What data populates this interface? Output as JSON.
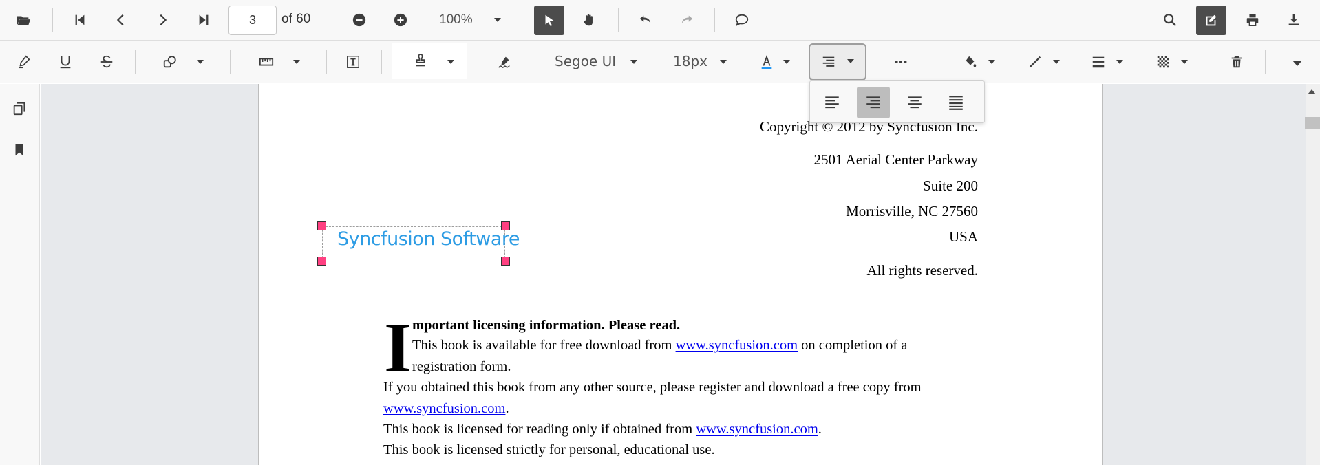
{
  "toolbar_top": {
    "open_icon": "folder-open-icon",
    "first_page_icon": "first-page-icon",
    "prev_page_icon": "prev-page-icon",
    "next_page_icon": "next-page-icon",
    "last_page_icon": "last-page-icon",
    "current_page": "3",
    "total_pages_label": "of 60",
    "zoom_out_icon": "zoom-out-icon",
    "zoom_in_icon": "zoom-in-icon",
    "zoom_value": "100%",
    "select_tool_icon": "pointer-icon",
    "pan_tool_icon": "hand-icon",
    "undo_icon": "undo-icon",
    "redo_icon": "redo-icon",
    "comment_icon": "comment-icon",
    "search_icon": "search-icon",
    "annotation_icon": "edit-annotation-icon",
    "print_icon": "print-icon",
    "download_icon": "download-icon"
  },
  "toolbar_annotation": {
    "font_family": "Segoe UI",
    "font_size": "18px",
    "font_color_icon": "font-color-icon",
    "align_icon": "align-right-icon",
    "more_icon": "more-icon",
    "fill_color_icon": "fill-color-icon",
    "stroke_color_icon": "stroke-color-icon",
    "thickness_icon": "thickness-icon",
    "opacity_icon": "opacity-icon",
    "delete_icon": "delete-icon",
    "accent_underline_color": "#2196f3"
  },
  "align_popup": {
    "options": [
      "align-left",
      "align-right",
      "align-center",
      "align-justify"
    ],
    "selected": "align-right"
  },
  "sidebar": {
    "items": [
      "page-thumbnails-icon",
      "bookmarks-icon"
    ]
  },
  "document": {
    "address_lines": [
      "Copyright © 2012 by Syncfusion Inc.",
      "2501 Aerial Center Parkway",
      "Suite 200",
      "Morrisville, NC 27560",
      "USA",
      "All rights reserved."
    ],
    "free_text_annotation": "Syncfusion Software",
    "dropcap": "I",
    "heading_rest": "mportant licensing information. Please read.",
    "p1_a": "This book is available for free download from ",
    "p1_link": "www.syncfusion.com",
    "p1_b": " on completion of a",
    "p1_c": "registration form.",
    "p2_a": "If you obtained this book from any other source, please register and download a free copy from",
    "p2_link": "www.syncfusion.com",
    "p2_b": ".",
    "p3_a": "This book is licensed for reading only if obtained from ",
    "p3_link": "www.syncfusion.com",
    "p3_b": ".",
    "p4": "This book is licensed strictly for personal, educational use."
  }
}
